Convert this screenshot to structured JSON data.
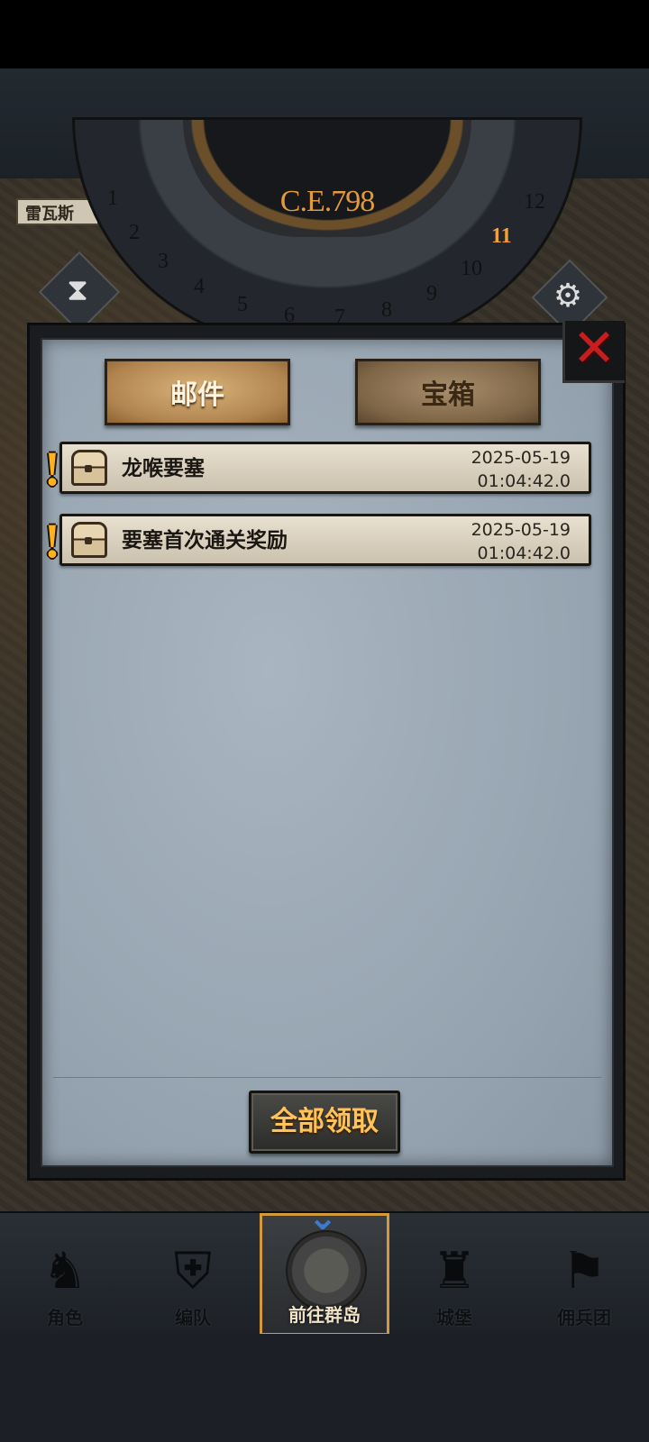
{
  "header": {
    "era": "C.E.798",
    "map_label": "雷瓦斯",
    "dial_numbers": [
      "1",
      "2",
      "3",
      "4",
      "5",
      "6",
      "7",
      "8",
      "9",
      "10",
      "11",
      "12"
    ],
    "current_hour": "11"
  },
  "dialog": {
    "tabs": [
      {
        "label": "邮件",
        "active": true
      },
      {
        "label": "宝箱",
        "active": false
      }
    ],
    "mails": [
      {
        "title": "龙喉要塞",
        "date": "2025-05-19",
        "time": "01:04:42.0",
        "alert_glyph": "!",
        "icon": "chest-icon"
      },
      {
        "title": "要塞首次通关奖励",
        "date": "2025-05-19",
        "time": "01:04:42.0",
        "alert_glyph": "!",
        "icon": "chest-icon"
      }
    ],
    "collect_all_label": "全部领取",
    "close_glyph": "✕"
  },
  "nav": {
    "items": [
      {
        "label": "角色",
        "icon": "knight-icon",
        "glyph": "♞"
      },
      {
        "label": "编队",
        "icon": "helmet-icon",
        "glyph": "⛨"
      },
      {
        "label": "前往群岛",
        "icon": "compass-icon",
        "glyph": "",
        "active": true
      },
      {
        "label": "城堡",
        "icon": "castle-icon",
        "glyph": "♜"
      },
      {
        "label": "佣兵团",
        "icon": "banner-icon",
        "glyph": "⚑"
      }
    ],
    "active_chevron": "⌄"
  },
  "colors": {
    "accent_gold": "#d39a3a",
    "alert_yellow": "#ffb21c",
    "close_red": "#c81d1d",
    "button_text": "#ffc35a"
  }
}
